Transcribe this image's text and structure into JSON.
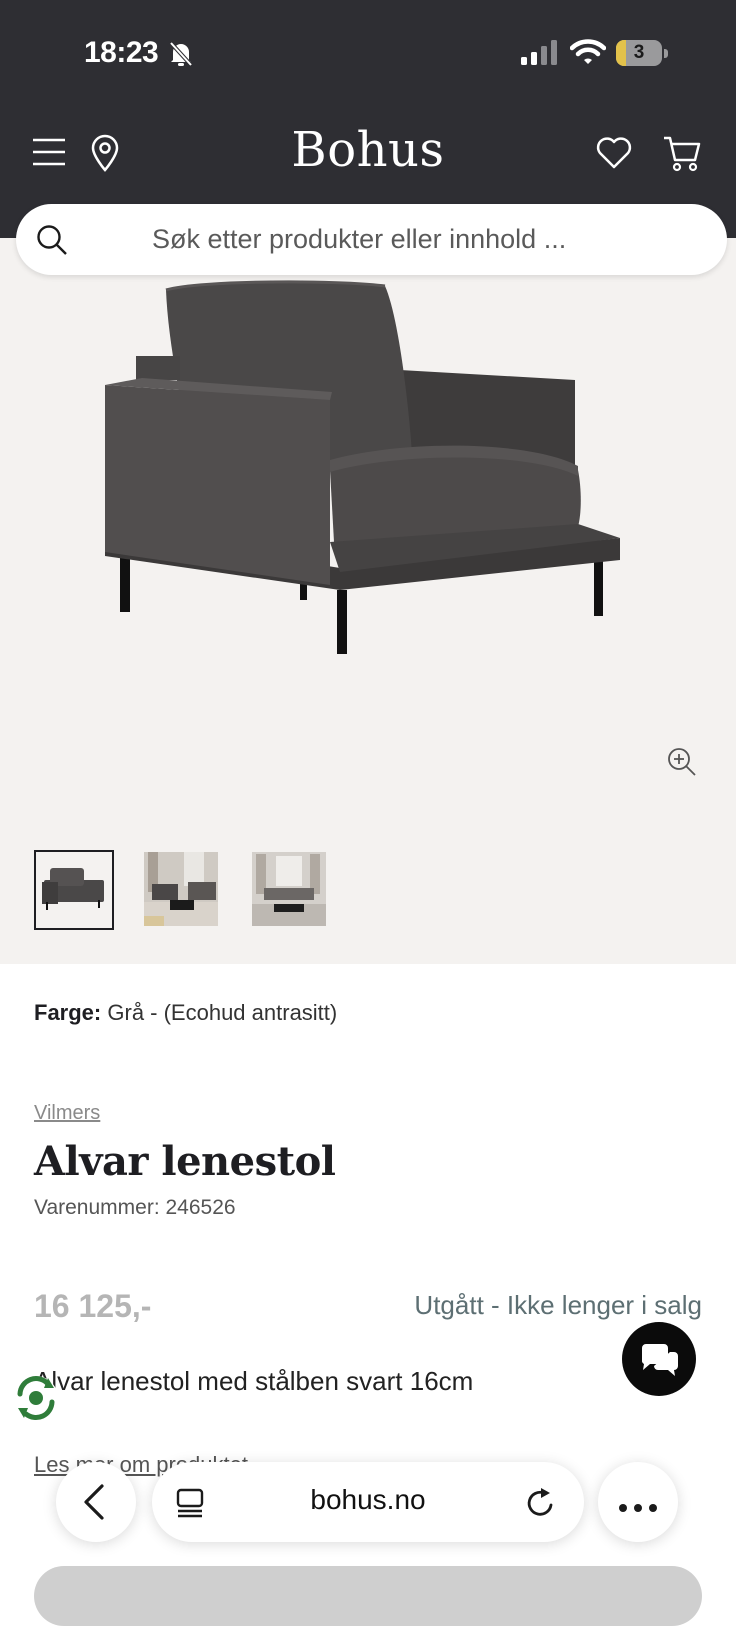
{
  "status_bar": {
    "time": "18:23",
    "battery": "3"
  },
  "header": {
    "brand": "Bohus"
  },
  "search": {
    "placeholder": "Søk etter produkter eller innhold ..."
  },
  "product": {
    "color_label": "Farge:",
    "color_value": "Grå - (Ecohud antrasitt)",
    "brand": "Vilmers",
    "title": "Alvar lenestol",
    "item_number": "Varenummer: 246526",
    "price": "16 125,-",
    "status": "Utgått - Ikke lenger i salg",
    "description": "Alvar lenestol med stålben svart 16cm",
    "read_more": "Les mer om produktet"
  },
  "browser": {
    "url": "bohus.no"
  },
  "icons": [
    "menu-icon",
    "location-pin-icon",
    "heart-icon",
    "cart-icon",
    "search-icon",
    "zoom-in-icon",
    "chat-icon",
    "back-icon",
    "tabs-icon",
    "reload-icon",
    "more-icon"
  ],
  "colors": {
    "header_bg": "#2e2e33",
    "gallery_bg": "#f4f2f0",
    "status_text": "#5d6f73",
    "price_muted": "#b5b5b5"
  }
}
